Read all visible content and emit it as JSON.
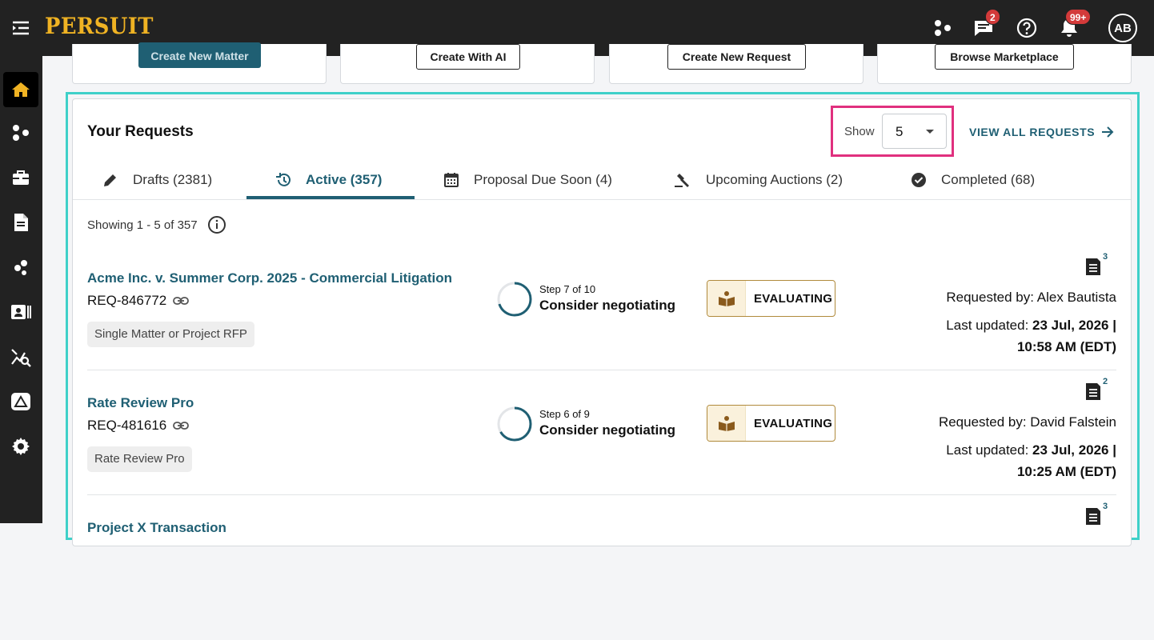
{
  "app": {
    "logo": "PERSUIT"
  },
  "topbar": {
    "messages_badge": "2",
    "notifications_badge": "99+",
    "avatar_initials": "AB"
  },
  "quick_actions": [
    {
      "label": "Create New Matter"
    },
    {
      "label": "Create With AI"
    },
    {
      "label": "Create New Request"
    },
    {
      "label": "Browse Marketplace"
    }
  ],
  "requests_panel": {
    "title": "Your Requests",
    "show_label": "Show",
    "show_value": "5",
    "view_all_label": "VIEW ALL REQUESTS",
    "tabs": [
      {
        "label": "Drafts (2381)"
      },
      {
        "label": "Active (357)"
      },
      {
        "label": "Proposal Due Soon (4)"
      },
      {
        "label": "Upcoming Auctions (2)"
      },
      {
        "label": "Completed (68)"
      }
    ],
    "showing_text": "Showing 1 - 5 of 357",
    "items": [
      {
        "title": "Acme Inc. v. Summer Corp. 2025 - Commercial Litigation",
        "id": "REQ-846772",
        "tag": "Single Matter or Project RFP",
        "step_small": "Step 7 of 10",
        "step_label": "Consider negotiating",
        "step_progress": 0.7,
        "status": "EVALUATING",
        "doc_count": "3",
        "requested_by": "Requested by: Alex Bautista",
        "updated_prefix": "Last updated: ",
        "updated_date": "23 Jul, 2026 |",
        "updated_time": "10:58 AM (EDT)"
      },
      {
        "title": "Rate Review Pro",
        "id": "REQ-481616",
        "tag": "Rate Review Pro",
        "step_small": "Step 6 of 9",
        "step_label": "Consider negotiating",
        "step_progress": 0.667,
        "status": "EVALUATING",
        "doc_count": "2",
        "requested_by": "Requested by: David Falstein",
        "updated_prefix": "Last updated: ",
        "updated_date": "23 Jul, 2026 |",
        "updated_time": "10:25 AM (EDT)"
      },
      {
        "title": "Project X Transaction",
        "doc_count": "3"
      }
    ]
  },
  "colors": {
    "brand_gold": "#f0b323",
    "accent_teal": "#1f5f73",
    "highlight_cyan": "#3fd0c9",
    "highlight_pink": "#e0307e"
  }
}
